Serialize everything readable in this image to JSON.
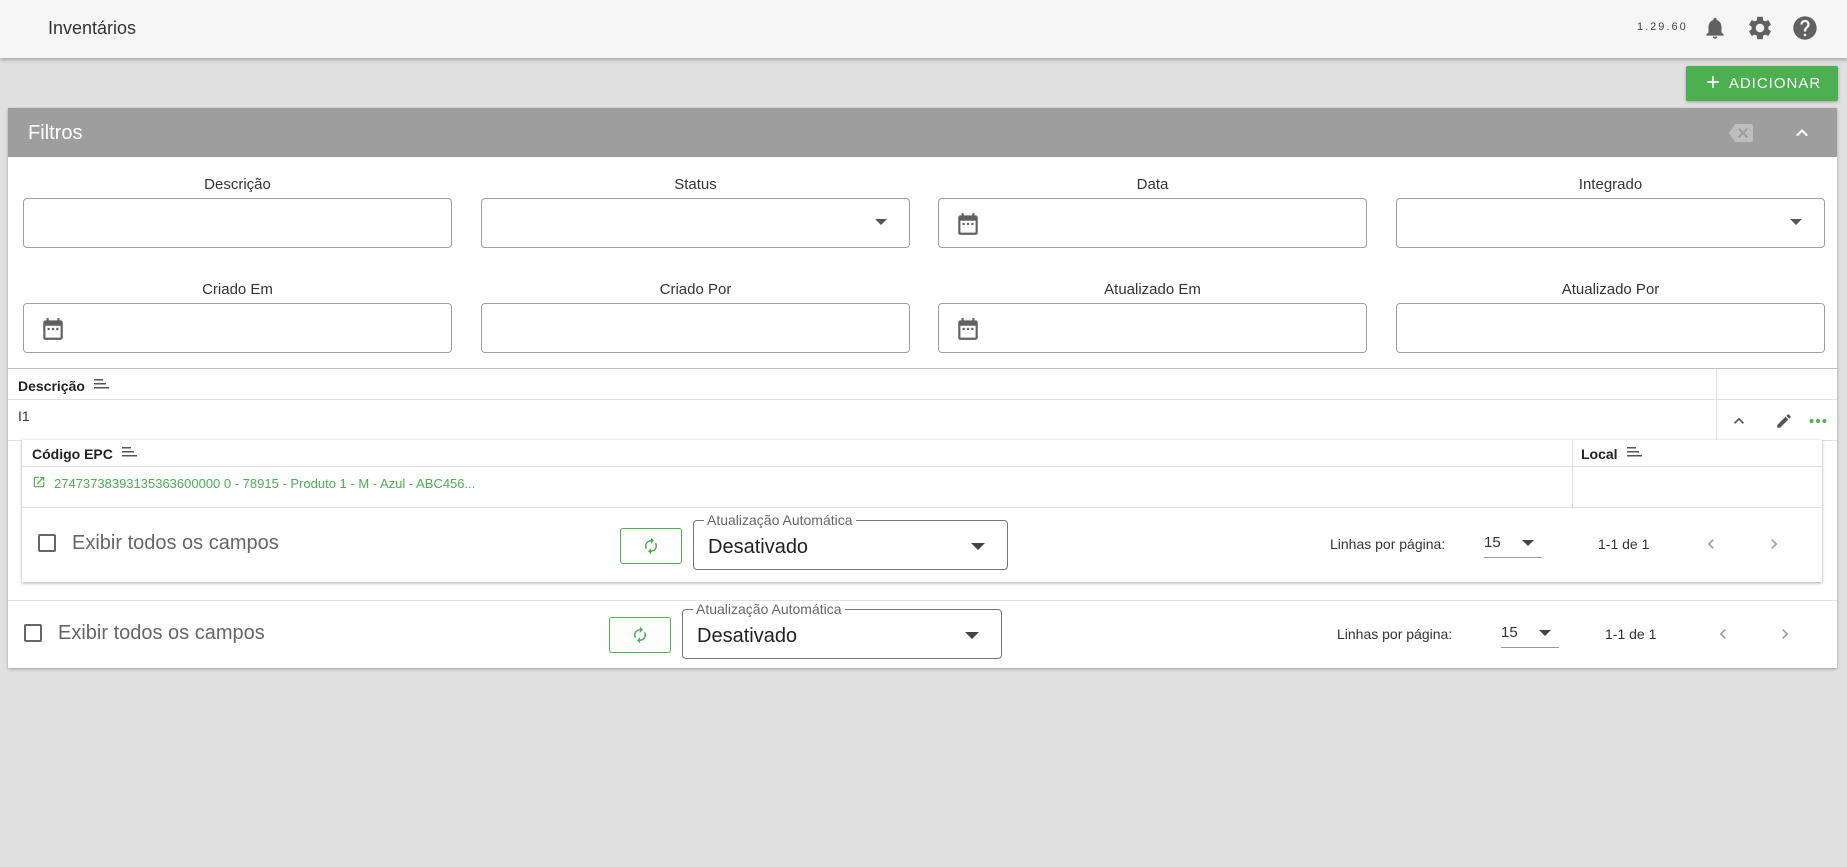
{
  "app": {
    "title": "Inventários",
    "version": "1.29.60"
  },
  "toolbar": {
    "add_label": "ADICIONAR"
  },
  "filters": {
    "title": "Filtros",
    "fields": [
      {
        "label": "Descrição",
        "value": ""
      },
      {
        "label": "Status",
        "value": ""
      },
      {
        "label": "Data",
        "value": ""
      },
      {
        "label": "Integrado",
        "value": ""
      },
      {
        "label": "Criado Em",
        "value": ""
      },
      {
        "label": "Criado Por",
        "value": ""
      },
      {
        "label": "Atualizado Em",
        "value": ""
      },
      {
        "label": "Atualizado Por",
        "value": ""
      }
    ]
  },
  "grid": {
    "column": "Descrição",
    "rows": [
      {
        "descricao": "I1"
      }
    ]
  },
  "detail": {
    "columns": {
      "codigo": "Código EPC",
      "local": "Local"
    },
    "rows": [
      {
        "codigo": "27473738393135363600000 0 - 78915 - Produto 1 - M - Azul - ABC456...",
        "local": ""
      }
    ]
  },
  "inner_footer": {
    "show_all": "Exibir todos os campos",
    "auto_label": "Atualização Automática",
    "auto_value": "Desativado",
    "rows_label": "Linhas por página:",
    "rows_value": "15",
    "page_info": "1-1 de 1"
  },
  "outer_footer": {
    "show_all": "Exibir todos os campos",
    "auto_label": "Atualização Automática",
    "auto_value": "Desativado",
    "rows_label": "Linhas por página:",
    "rows_value": "15",
    "page_info": "1-1 de 1"
  },
  "colors": {
    "accent": "#4caf50",
    "header_gray": "#9e9e9e",
    "background": "#e0e0e0"
  }
}
